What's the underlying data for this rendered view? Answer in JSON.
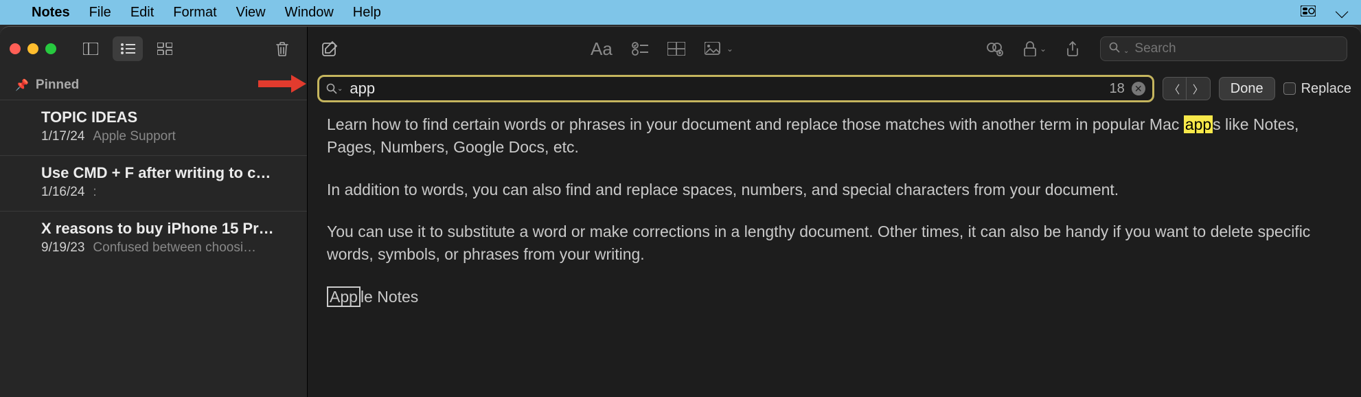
{
  "menubar": {
    "app": "Notes",
    "items": [
      "File",
      "Edit",
      "Format",
      "View",
      "Window",
      "Help"
    ]
  },
  "sidebar": {
    "pinned_label": "Pinned",
    "notes": [
      {
        "title": "TOPIC IDEAS",
        "date": "1/17/24",
        "preview": "Apple Support"
      },
      {
        "title": "Use CMD + F after writing to c…",
        "date": "1/16/24",
        "preview": ":"
      },
      {
        "title": "X reasons to buy iPhone 15 Pr…",
        "date": "9/19/23",
        "preview": "Confused between choosi…"
      }
    ]
  },
  "toolbar": {
    "search_placeholder": "Search"
  },
  "findbar": {
    "query": "app",
    "count": "18",
    "done": "Done",
    "replace": "Replace"
  },
  "content": {
    "p1a": "Learn how to find certain words or phrases in your document and replace those matches with another term in popular Mac ",
    "p1_hl": "app",
    "p1b": "s like Notes, Pages, Numbers, Google Docs, etc.",
    "p2": "In addition to words, you can also find and replace spaces, numbers, and special characters from your document.",
    "p3": "You can use it to substitute a word or make corrections in a lengthy document. Other times, it can also be handy if you want to delete specific words, symbols, or phrases from your writing.",
    "p4_hl": "App",
    "p4_rest": "le Notes"
  }
}
